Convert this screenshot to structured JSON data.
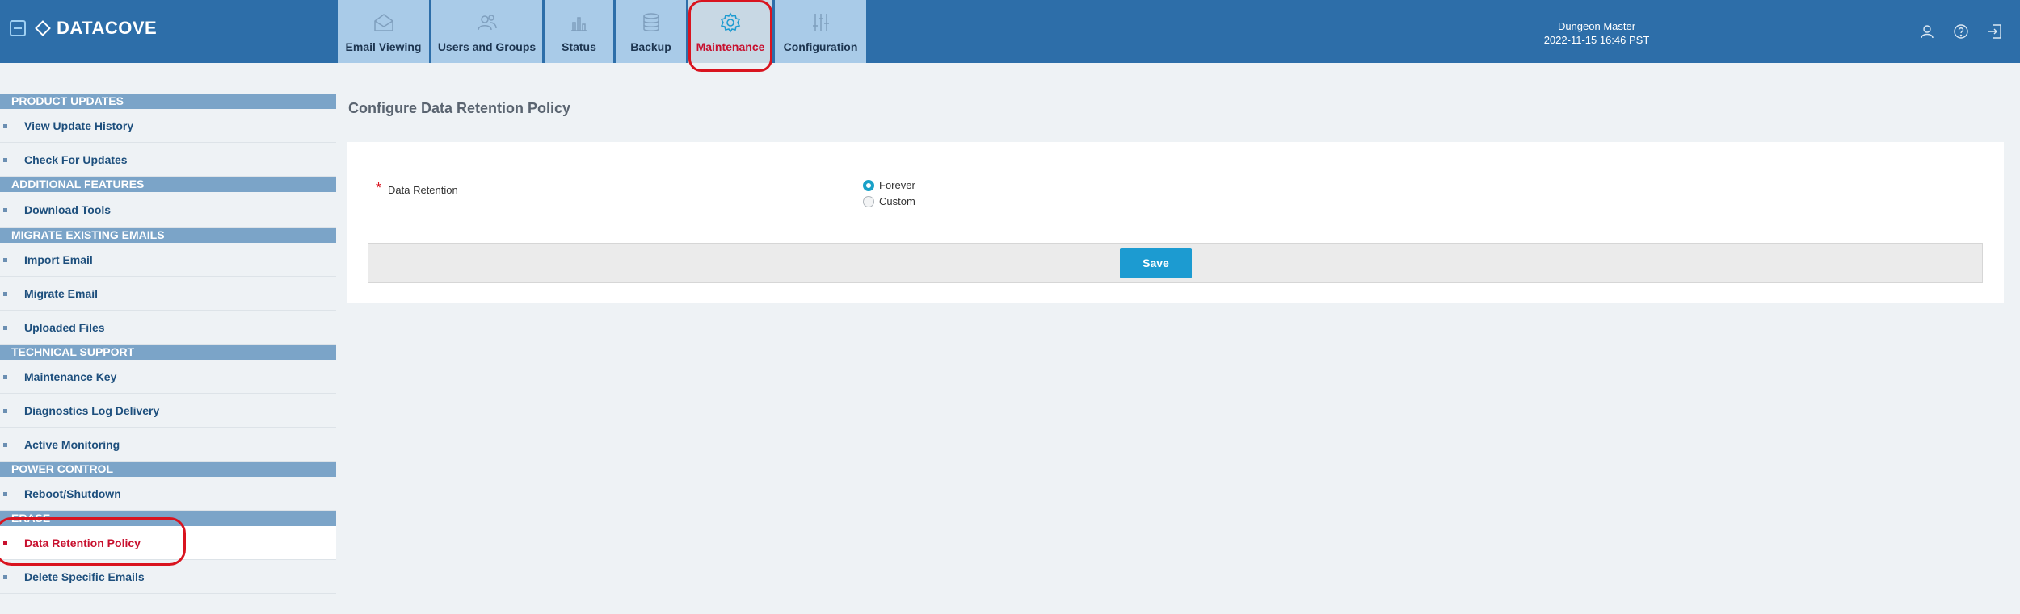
{
  "app": {
    "brand": "DATACOVE"
  },
  "nav": {
    "tabs": [
      {
        "label": "Email Viewing",
        "icon": "envelope-icon"
      },
      {
        "label": "Users and Groups",
        "icon": "users-icon"
      },
      {
        "label": "Status",
        "icon": "bar-chart-icon"
      },
      {
        "label": "Backup",
        "icon": "database-icon"
      },
      {
        "label": "Maintenance",
        "icon": "gear-icon",
        "active": true
      },
      {
        "label": "Configuration",
        "icon": "sliders-icon"
      }
    ]
  },
  "user": {
    "name": "Dungeon Master",
    "datetime": "2022-11-15 16:46 PST"
  },
  "sidebar": {
    "sections": [
      {
        "title": "PRODUCT UPDATES",
        "items": [
          "View Update History",
          "Check For Updates"
        ]
      },
      {
        "title": "ADDITIONAL FEATURES",
        "items": [
          "Download Tools"
        ]
      },
      {
        "title": "MIGRATE EXISTING EMAILS",
        "items": [
          "Import Email",
          "Migrate Email",
          "Uploaded Files"
        ]
      },
      {
        "title": "TECHNICAL SUPPORT",
        "items": [
          "Maintenance Key",
          "Diagnostics Log Delivery",
          "Active Monitoring"
        ]
      },
      {
        "title": "POWER CONTROL",
        "items": [
          "Reboot/Shutdown"
        ]
      },
      {
        "title": "ERASE",
        "items": [
          "Data Retention Policy",
          "Delete Specific Emails"
        ]
      }
    ]
  },
  "main": {
    "title": "Configure Data Retention Policy",
    "field_label": "Data Retention",
    "required_mark": "*",
    "options": [
      "Forever",
      "Custom"
    ],
    "selected_option": "Forever",
    "save_label": "Save"
  },
  "colors": {
    "header": "#2d6ea9",
    "accent": "#c8102e",
    "button": "#1c9bd1"
  }
}
